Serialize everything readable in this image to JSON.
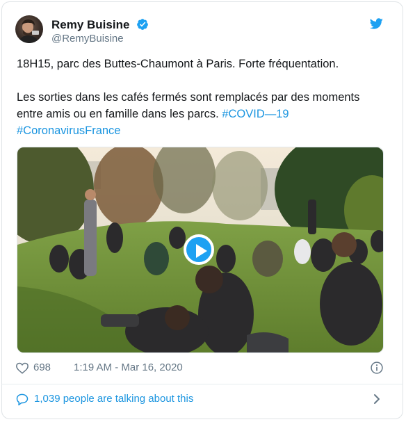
{
  "author": {
    "name": "Remy Buisine",
    "handle": "@RemyBuisine",
    "avatar_icon": "avatar-photo",
    "verified": true
  },
  "tweet": {
    "line1": "18H15, parc des Buttes-Chaumont à Paris. Forte fréquentation.",
    "line2": "Les sorties dans les cafés fermés sont remplacés par des moments entre amis ou en famille dans les parcs.",
    "hashtag1": "#COVID—19",
    "hashtag2": "#CoronavirusFrance"
  },
  "media": {
    "type": "video",
    "play_icon": "play-icon"
  },
  "meta": {
    "likes": "698",
    "timestamp": "1:19 AM - Mar 16, 2020",
    "info_icon": "info-icon"
  },
  "conversation": {
    "label": "1,039 people are talking about this"
  },
  "colors": {
    "accent": "#1da1f2",
    "link": "#1b95e0",
    "muted": "#657786"
  }
}
